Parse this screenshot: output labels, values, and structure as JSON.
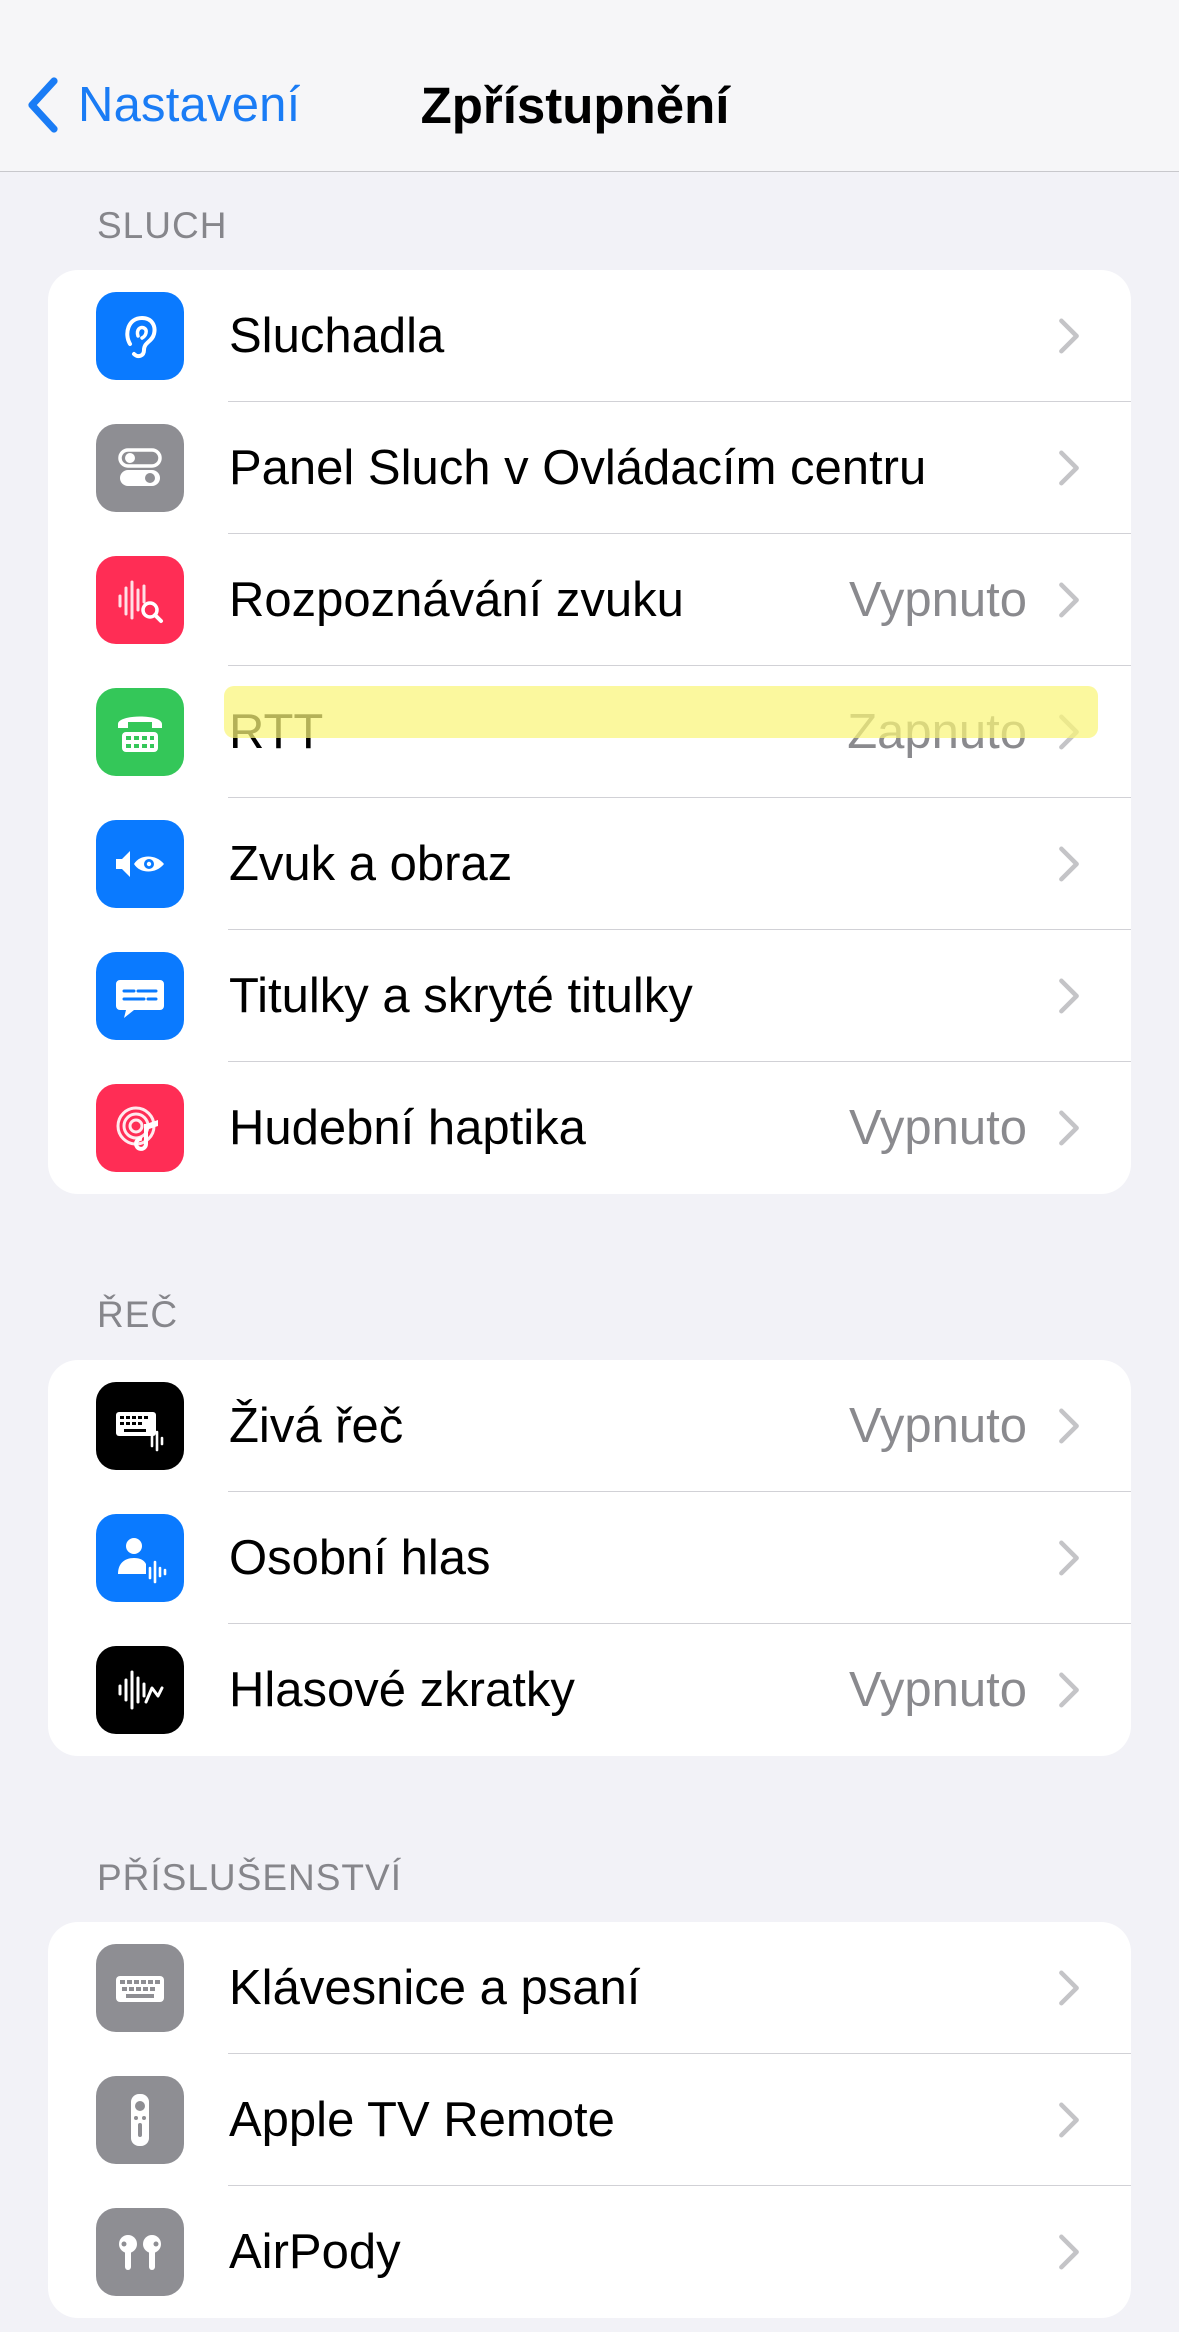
{
  "nav": {
    "back_label": "Nastavení",
    "title": "Zpřístupnění"
  },
  "sections": [
    {
      "header": "SLUCH",
      "items": [
        {
          "label": "Sluchadla",
          "value": "",
          "icon": "ear-icon",
          "color": "#0a7aff"
        },
        {
          "label": "Panel Sluch v Ovládacím centru",
          "value": "",
          "icon": "toggles-icon",
          "color": "#8e8e93"
        },
        {
          "label": "Rozpoznávání zvuku",
          "value": "Vypnuto",
          "icon": "sound-recognition-icon",
          "color": "#ff2d55"
        },
        {
          "label": "RTT",
          "value": "Zapnuto",
          "icon": "tty-phone-icon",
          "color": "#34c759"
        },
        {
          "label": "Zvuk a obraz",
          "value": "",
          "icon": "speaker-eye-icon",
          "color": "#0a7aff"
        },
        {
          "label": "Titulky a skryté titulky",
          "value": "",
          "icon": "captions-bubble-icon",
          "color": "#0a7aff"
        },
        {
          "label": "Hudební haptika",
          "value": "Vypnuto",
          "icon": "music-haptics-icon",
          "color": "#ff2d55"
        }
      ]
    },
    {
      "header": "ŘEČ",
      "items": [
        {
          "label": "Živá řeč",
          "value": "Vypnuto",
          "icon": "keyboard-waveform-icon",
          "color": "#000000"
        },
        {
          "label": "Osobní hlas",
          "value": "",
          "icon": "person-waveform-icon",
          "color": "#0a7aff"
        },
        {
          "label": "Hlasové zkratky",
          "value": "Vypnuto",
          "icon": "waveform-shortcut-icon",
          "color": "#000000"
        }
      ]
    },
    {
      "header": "PŘÍSLUŠENSTVÍ",
      "items": [
        {
          "label": "Klávesnice a psaní",
          "value": "",
          "icon": "keyboard-icon",
          "color": "#8e8e93"
        },
        {
          "label": "Apple TV Remote",
          "value": "",
          "icon": "tv-remote-icon",
          "color": "#8e8e93"
        },
        {
          "label": "AirPody",
          "value": "",
          "icon": "airpods-icon",
          "color": "#8e8e93"
        }
      ]
    }
  ],
  "highlighted_item": "RTT",
  "accent_color": "#1a7cf5",
  "highlight_color": "#faf578"
}
